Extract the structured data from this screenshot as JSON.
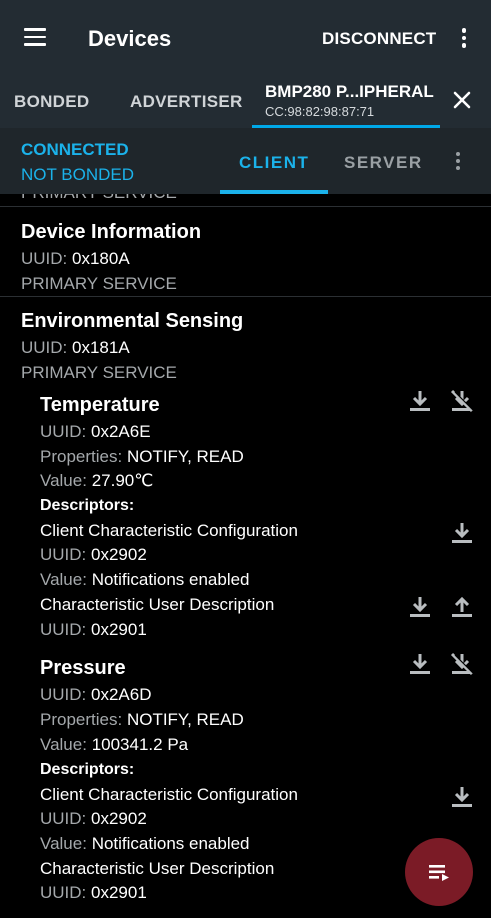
{
  "appbar": {
    "title": "Devices",
    "disconnect_label": "DISCONNECT",
    "menu_icon": "hamburger-menu-icon",
    "overflow_icon": "more-vert-icon"
  },
  "tabs": {
    "bonded": "BONDED",
    "advertiser": "ADVERTISER",
    "device_name": "BMP280 P...IPHERAL",
    "device_address": "CC:98:82:98:87:71",
    "close_icon": "close-icon"
  },
  "status": {
    "connection": "CONNECTED",
    "bond": "NOT BONDED",
    "client_tab": "CLIENT",
    "server_tab": "SERVER"
  },
  "services": {
    "partial": {
      "type": "PRIMARY SERVICE"
    },
    "device_info": {
      "name": "Device Information",
      "uuid_label": "UUID:",
      "uuid": "0x180A",
      "type": "PRIMARY SERVICE"
    },
    "env": {
      "name": "Environmental Sensing",
      "uuid_label": "UUID:",
      "uuid": "0x181A",
      "type": "PRIMARY SERVICE"
    }
  },
  "characteristics": {
    "temperature": {
      "name": "Temperature",
      "uuid_label": "UUID:",
      "uuid": "0x2A6E",
      "props_label": "Properties:",
      "props": "NOTIFY, READ",
      "value_label": "Value:",
      "value": "27.90℃",
      "descriptors_label": "Descriptors:",
      "cccd_name": "Client Characteristic Configuration",
      "cccd_uuid_label": "UUID:",
      "cccd_uuid": "0x2902",
      "cccd_value_label": "Value:",
      "cccd_value": "Notifications enabled",
      "cud_name": "Characteristic User Description",
      "cud_uuid_label": "UUID:",
      "cud_uuid": "0x2901"
    },
    "pressure": {
      "name": "Pressure",
      "uuid_label": "UUID:",
      "uuid": "0x2A6D",
      "props_label": "Properties:",
      "props": "NOTIFY, READ",
      "value_label": "Value:",
      "value": "100341.2 Pa",
      "descriptors_label": "Descriptors:",
      "cccd_name": "Client Characteristic Configuration",
      "cccd_uuid_label": "UUID:",
      "cccd_uuid": "0x2902",
      "cccd_value_label": "Value:",
      "cccd_value": "Notifications enabled",
      "cud_name": "Characteristic User Description",
      "cud_uuid_label": "UUID:",
      "cud_uuid": "0x2901"
    }
  },
  "icons": {
    "read": "download-arrow-icon",
    "write": "upload-arrow-icon",
    "notify_off": "notifications-disabled-icon",
    "fab": "log-list-icon"
  },
  "colors": {
    "appbar": "#232c33",
    "accent": "#1bb2ea",
    "fab": "#7b1b26",
    "secondary_text": "#a4a8ab"
  }
}
